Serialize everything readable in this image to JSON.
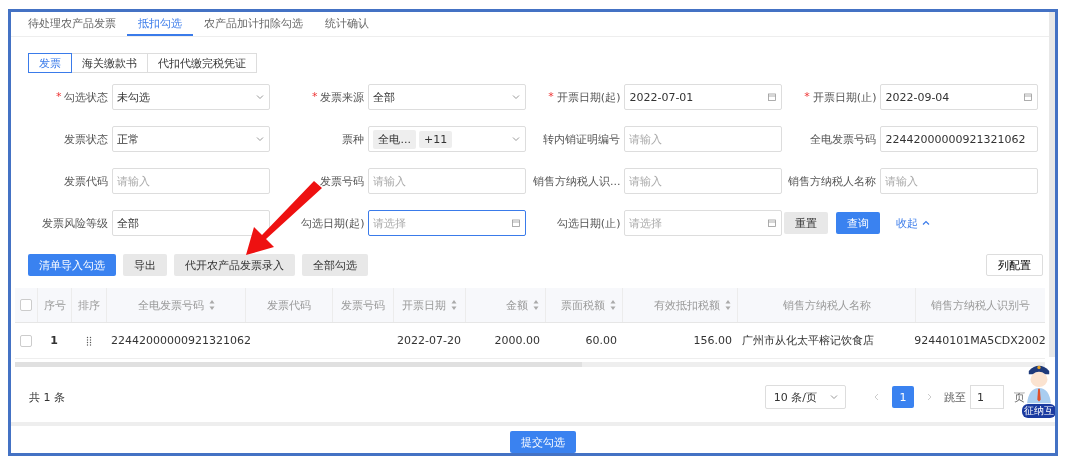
{
  "tabs": [
    {
      "label": "待处理农产品发票",
      "selected": false
    },
    {
      "label": "抵扣勾选",
      "selected": true
    },
    {
      "label": "农产品加计扣除勾选",
      "selected": false
    },
    {
      "label": "统计确认",
      "selected": false
    }
  ],
  "subtabs": [
    {
      "label": "发票",
      "selected": true
    },
    {
      "label": "海关缴款书",
      "selected": false
    },
    {
      "label": "代扣代缴完税凭证",
      "selected": false
    }
  ],
  "filters": [
    {
      "label": "勾选状态",
      "mark": "*",
      "kind": "select",
      "value": "未勾选"
    },
    {
      "label": "发票来源",
      "mark": "*",
      "kind": "select",
      "value": "全部"
    },
    {
      "label": "开票日期(起)",
      "mark": "*",
      "kind": "date",
      "value": "2022-07-01"
    },
    {
      "label": "开票日期(止)",
      "mark": "*",
      "kind": "date",
      "value": "2022-09-04"
    },
    {
      "label": "发票状态",
      "kind": "select",
      "value": "正常"
    },
    {
      "label": "票种",
      "kind": "tags",
      "tags": [
        "全电...",
        "+11"
      ]
    },
    {
      "label": "转内销证明编号",
      "kind": "input",
      "placeholder": "请输入"
    },
    {
      "label": "全电发票号码",
      "kind": "input",
      "value": "22442000000921321062"
    },
    {
      "label": "发票代码",
      "kind": "input",
      "placeholder": "请输入"
    },
    {
      "label": "发票号码",
      "kind": "input",
      "placeholder": "请输入"
    },
    {
      "label": "销售方纳税人识...",
      "kind": "input",
      "placeholder": "请输入"
    },
    {
      "label": "销售方纳税人名称",
      "kind": "input",
      "placeholder": "请输入"
    },
    {
      "label": "发票风险等级",
      "kind": "input",
      "value": "全部"
    },
    {
      "label": "勾选日期(起)",
      "kind": "date",
      "placeholder": "请选择",
      "focused": true
    },
    {
      "label": "勾选日期(止)",
      "kind": "date",
      "placeholder": "请选择",
      "focused": false
    }
  ],
  "reset": "重置",
  "query": "查询",
  "collapse": "收起",
  "actions": [
    {
      "label": "清单导入勾选",
      "primary": true
    },
    {
      "label": "导出",
      "primary": false
    },
    {
      "label": "代开农产品发票录入",
      "primary": false
    },
    {
      "label": "全部勾选",
      "primary": false
    }
  ],
  "column_config": "列配置",
  "select_all_checked": false,
  "columns": [
    {
      "label": "序号",
      "sortable": false
    },
    {
      "label": "排序",
      "sortable": false
    },
    {
      "label": "全电发票号码",
      "sortable": true
    },
    {
      "label": "发票代码",
      "sortable": false
    },
    {
      "label": "发票号码",
      "sortable": false
    },
    {
      "label": "开票日期",
      "sortable": true
    },
    {
      "label": "金额",
      "sortable": true
    },
    {
      "label": "票面税额",
      "sortable": true
    },
    {
      "label": "有效抵扣税额",
      "sortable": true
    },
    {
      "label": "销售方纳税人名称",
      "sortable": false
    },
    {
      "label": "销售方纳税人识别号",
      "sortable": false
    }
  ],
  "rows": [
    {
      "checked": false,
      "cells": [
        "1",
        "",
        "22442000000921321062",
        "",
        "",
        "2022-07-20",
        "2000.00",
        "60.00",
        "156.00",
        "广州市从化太平榕记饮食店",
        "92440101MA5CDX2002"
      ]
    }
  ],
  "total": "共 1 条",
  "page_size": "10 条/页",
  "pages": [
    {
      "label": "1",
      "selected": true
    }
  ],
  "jump_label": "跳至",
  "jump_value": "1",
  "page_suffix": "页",
  "assistant_badge": "征纳互",
  "submit": "提交勾选"
}
